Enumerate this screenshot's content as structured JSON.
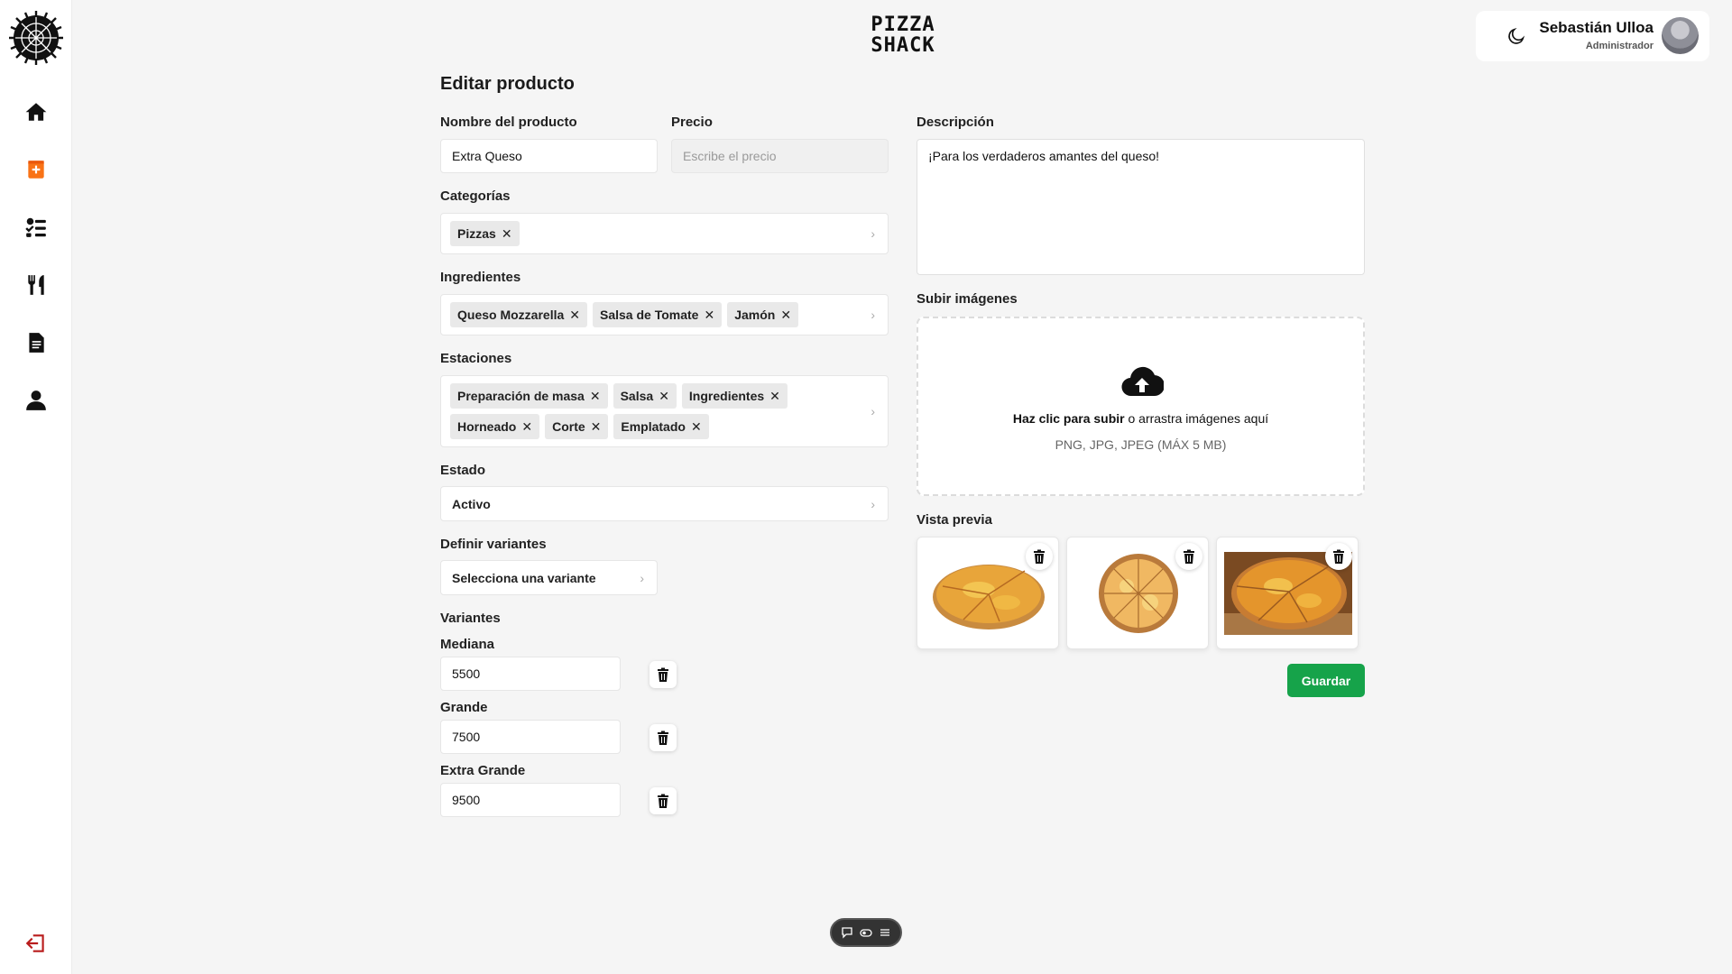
{
  "brand": {
    "line1": "PIZZA",
    "line2": "SHACK"
  },
  "user": {
    "name": "Sebastián Ulloa",
    "role": "Administrador"
  },
  "sidebar": {
    "items": [
      {
        "icon": "home-icon"
      },
      {
        "icon": "add-product-icon",
        "active": true,
        "color": "#f97316"
      },
      {
        "icon": "checklist-icon"
      },
      {
        "icon": "utensils-icon"
      },
      {
        "icon": "document-icon"
      },
      {
        "icon": "user-icon"
      }
    ],
    "logout_icon": "logout-icon",
    "logout_color": "#b91c1c"
  },
  "form": {
    "title": "Editar producto",
    "name": {
      "label": "Nombre del producto",
      "value": "Extra Queso"
    },
    "price": {
      "label": "Precio",
      "placeholder": "Escribe el precio"
    },
    "categories": {
      "label": "Categorías",
      "chips": [
        "Pizzas"
      ]
    },
    "ingredients": {
      "label": "Ingredientes",
      "chips": [
        "Queso Mozzarella",
        "Salsa de Tomate",
        "Jamón"
      ]
    },
    "stations": {
      "label": "Estaciones",
      "chips": [
        "Preparación de masa",
        "Salsa",
        "Ingredientes",
        "Horneado",
        "Corte",
        "Emplatado"
      ]
    },
    "status": {
      "label": "Estado",
      "value": "Activo"
    },
    "define_variants": {
      "label": "Definir variantes",
      "value": "Selecciona una variante"
    },
    "variants": {
      "label": "Variantes",
      "items": [
        {
          "name": "Mediana",
          "value": "5500"
        },
        {
          "name": "Grande",
          "value": "7500"
        },
        {
          "name": "Extra Grande",
          "value": "9500"
        }
      ]
    },
    "description": {
      "label": "Descripción",
      "value": "¡Para los verdaderos amantes del queso!"
    },
    "upload": {
      "label": "Subir imágenes",
      "cta_bold": "Haz clic para subir",
      "cta_rest": " o arrastra imágenes aquí",
      "formats": "PNG, JPG, JPEG (MÁX 5 MB)"
    },
    "preview": {
      "label": "Vista previa"
    },
    "save_label": "Guardar",
    "accent": "#16a34a"
  }
}
